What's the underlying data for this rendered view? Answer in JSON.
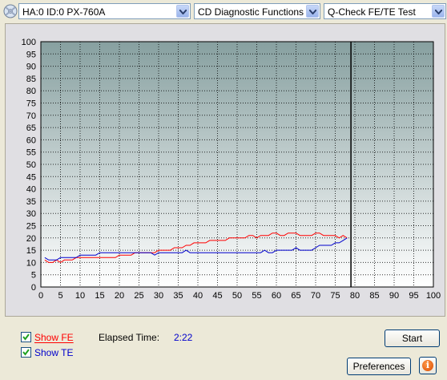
{
  "toolbar": {
    "drive_combo": "HA:0 ID:0  PX-760A",
    "function_combo": "CD Diagnostic Functions",
    "test_combo": "Q-Check FE/TE Test"
  },
  "chart_data": {
    "type": "line",
    "xlim": [
      0,
      100
    ],
    "ylim": [
      0,
      100
    ],
    "x_ticks": [
      "0",
      "5",
      "10",
      "15",
      "20",
      "25",
      "30",
      "35",
      "40",
      "45",
      "50",
      "55",
      "60",
      "65",
      "70",
      "75",
      "80",
      "85",
      "90",
      "95",
      "100"
    ],
    "y_ticks": [
      "0",
      "5",
      "10",
      "15",
      "20",
      "25",
      "30",
      "35",
      "40",
      "45",
      "50",
      "55",
      "60",
      "65",
      "70",
      "75",
      "80",
      "85",
      "90",
      "95",
      "100"
    ],
    "grid": true,
    "marker_x": 79,
    "series": [
      {
        "color": "#ff0000",
        "x": [
          1,
          2,
          3,
          4,
          5,
          6,
          7,
          8,
          9,
          10,
          11,
          12,
          13,
          14,
          15,
          16,
          17,
          18,
          19,
          20,
          21,
          22,
          23,
          24,
          25,
          26,
          27,
          28,
          29,
          30,
          31,
          32,
          33,
          34,
          35,
          36,
          37,
          38,
          39,
          40,
          41,
          42,
          43,
          44,
          45,
          46,
          47,
          48,
          49,
          50,
          51,
          52,
          53,
          54,
          55,
          56,
          57,
          58,
          59,
          60,
          61,
          62,
          63,
          64,
          65,
          66,
          67,
          68,
          69,
          70,
          71,
          72,
          73,
          74,
          75,
          76,
          77,
          78
        ],
        "values": [
          11,
          10,
          10,
          11,
          10,
          11,
          11,
          11,
          12,
          12,
          12,
          12,
          12,
          12,
          12,
          12,
          12,
          12,
          12,
          13,
          13,
          13,
          13,
          14,
          14,
          14,
          14,
          14,
          14,
          15,
          15,
          15,
          15,
          16,
          16,
          16,
          17,
          17,
          18,
          18,
          18,
          18,
          19,
          19,
          19,
          19,
          19,
          20,
          20,
          20,
          20,
          20,
          21,
          21,
          20,
          21,
          21,
          21,
          22,
          22,
          21,
          21,
          22,
          22,
          22,
          21,
          21,
          21,
          21,
          22,
          22,
          21,
          21,
          21,
          21,
          20,
          21,
          20
        ]
      },
      {
        "color": "#0000cc",
        "x": [
          1,
          2,
          3,
          4,
          5,
          6,
          7,
          8,
          9,
          10,
          11,
          12,
          13,
          14,
          15,
          16,
          17,
          18,
          19,
          20,
          21,
          22,
          23,
          24,
          25,
          26,
          27,
          28,
          29,
          30,
          31,
          32,
          33,
          34,
          35,
          36,
          37,
          38,
          39,
          40,
          41,
          42,
          43,
          44,
          45,
          46,
          47,
          48,
          49,
          50,
          51,
          52,
          53,
          54,
          55,
          56,
          57,
          58,
          59,
          60,
          61,
          62,
          63,
          64,
          65,
          66,
          67,
          68,
          69,
          70,
          71,
          72,
          73,
          74,
          75,
          76,
          77,
          78
        ],
        "values": [
          12,
          11,
          11,
          11,
          12,
          12,
          12,
          12,
          12,
          13,
          13,
          13,
          13,
          13,
          14,
          14,
          14,
          14,
          14,
          14,
          14,
          14,
          14,
          14,
          14,
          14,
          14,
          14,
          13,
          14,
          14,
          14,
          14,
          14,
          14,
          14,
          15,
          14,
          14,
          14,
          14,
          14,
          14,
          14,
          14,
          14,
          14,
          14,
          14,
          14,
          14,
          14,
          14,
          14,
          14,
          14,
          15,
          14,
          14,
          15,
          15,
          15,
          15,
          15,
          16,
          15,
          15,
          15,
          15,
          16,
          17,
          17,
          17,
          17,
          18,
          18,
          19,
          20
        ]
      }
    ]
  },
  "bottom": {
    "show_fe_label": "Show FE",
    "show_te_label": "Show TE",
    "elapsed_label": "Elapsed Time:",
    "elapsed_value": "2:22",
    "start_label": "Start",
    "preferences_label": "Preferences",
    "info_glyph": "i",
    "fe_color": "#ff0000",
    "te_color": "#0000cc",
    "elapsed_value_color": "#0000cc"
  }
}
